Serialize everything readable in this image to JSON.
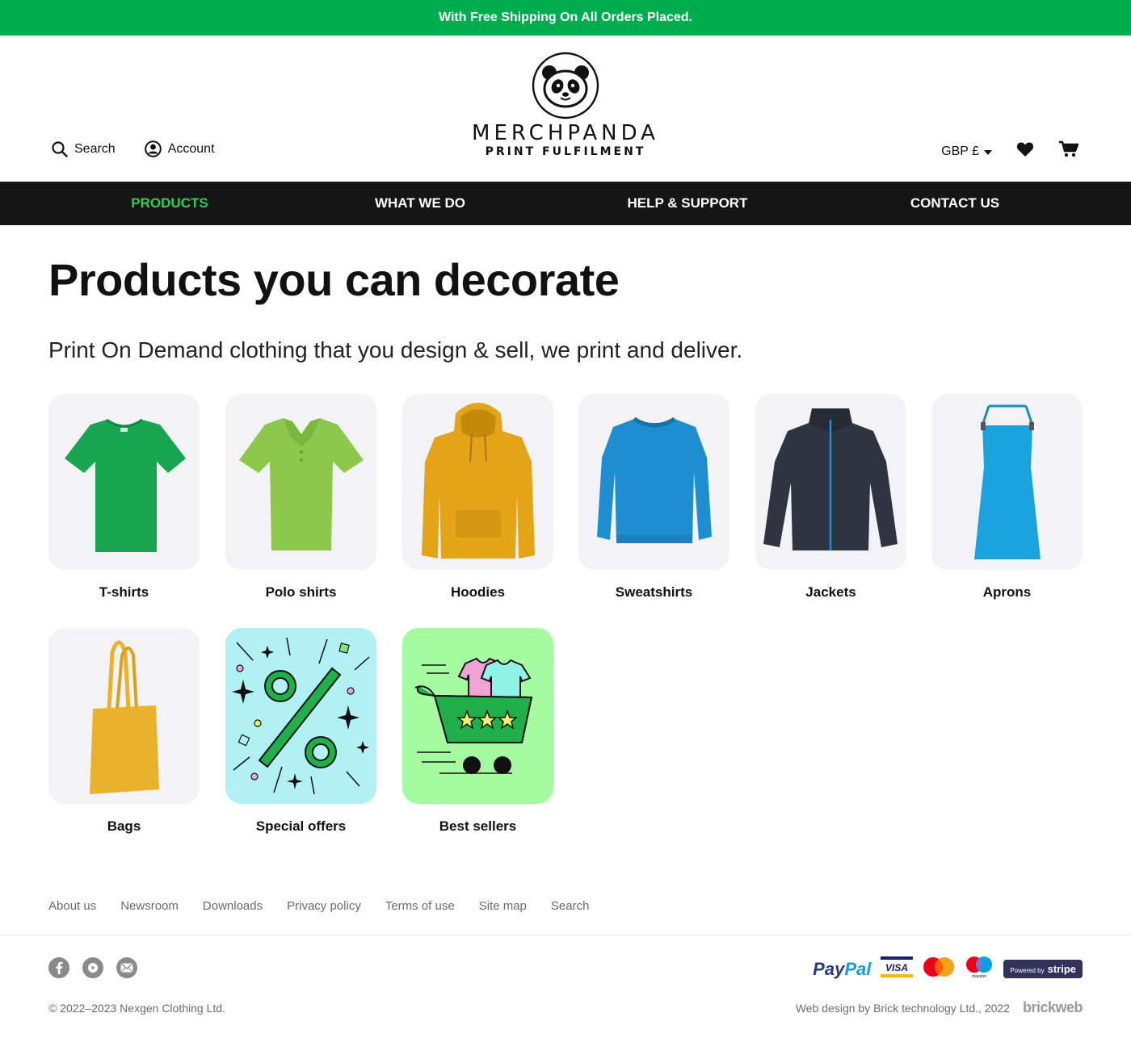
{
  "promo": {
    "text": "With Free Shipping On All Orders Placed."
  },
  "header": {
    "search_label": "Search",
    "account_label": "Account",
    "logo_name": "MERCHPANDA",
    "logo_sub": "PRINT FULFILMENT",
    "currency": "GBP £",
    "icons": [
      "search-icon",
      "account-icon",
      "panda-logo",
      "caret-down-icon",
      "heart-icon",
      "cart-icon"
    ]
  },
  "nav": {
    "items": [
      {
        "label": "PRODUCTS",
        "active": true
      },
      {
        "label": "WHAT WE DO",
        "active": false
      },
      {
        "label": "HELP & SUPPORT",
        "active": false
      },
      {
        "label": "CONTACT US",
        "active": false
      }
    ],
    "active_color": "#2fcf57"
  },
  "main": {
    "title": "Products you can decorate",
    "subtitle": "Print On Demand clothing that you design & sell, we print and deliver.",
    "products": [
      {
        "label": "T-shirts",
        "color": "#17a54f"
      },
      {
        "label": "Polo shirts",
        "color": "#8cc84b"
      },
      {
        "label": "Hoodies",
        "color": "#e3a418"
      },
      {
        "label": "Sweatshirts",
        "color": "#1d8fd0"
      },
      {
        "label": "Jackets",
        "color": "#2e3440"
      },
      {
        "label": "Aprons",
        "color": "#1aa3dc"
      },
      {
        "label": "Bags",
        "color": "#e9b22a"
      },
      {
        "label": "Special offers",
        "color": "#b1f0f3"
      },
      {
        "label": "Best sellers",
        "color": "#a5fba0"
      }
    ]
  },
  "footer": {
    "links": [
      "About us",
      "Newsroom",
      "Downloads",
      "Privacy policy",
      "Terms of use",
      "Site map",
      "Search"
    ],
    "social_icons": [
      "facebook-icon",
      "youtube-icon",
      "email-icon"
    ],
    "payments": {
      "paypal": "PayPal",
      "visa": "VISA",
      "maestro": "maestro",
      "stripe_prefix": "Powered by",
      "stripe": "stripe"
    },
    "copyright": "© 2022–2023 Nexgen Clothing Ltd.",
    "credit": "Web design by Brick technology Ltd., 2022",
    "credit_brand": "brickweb"
  },
  "colors": {
    "brand_green": "#00ad4e",
    "nav_bg": "#151515",
    "card_bg": "#f3f3f5"
  }
}
